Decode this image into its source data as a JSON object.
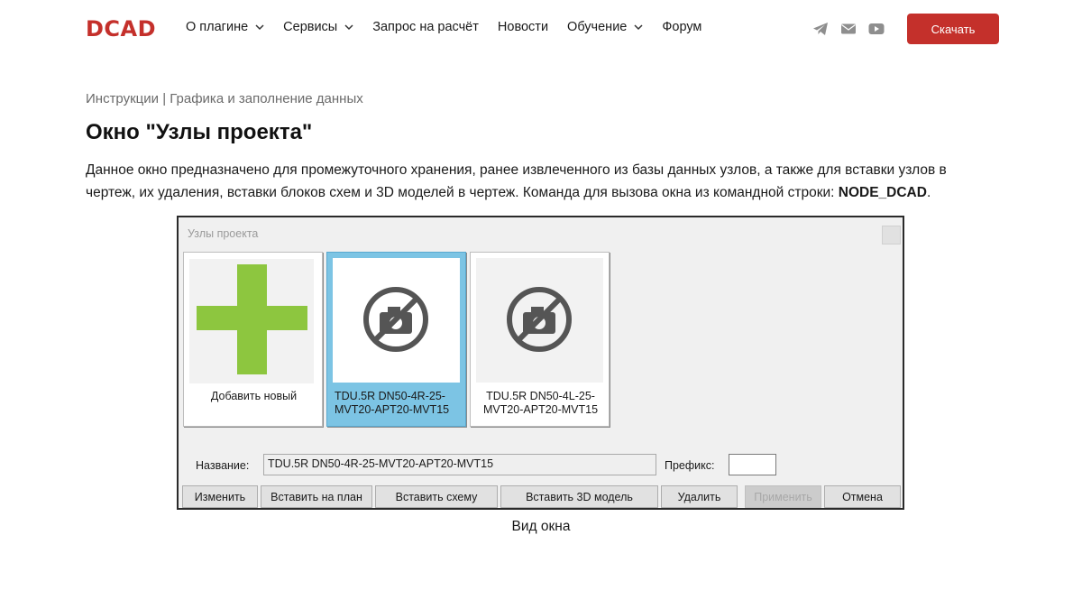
{
  "header": {
    "logo": "DCAD",
    "nav": [
      {
        "label": "О плагине",
        "dropdown": true
      },
      {
        "label": "Сервисы",
        "dropdown": true
      },
      {
        "label": "Запрос на расчёт",
        "dropdown": false
      },
      {
        "label": "Новости",
        "dropdown": false
      },
      {
        "label": "Обучение",
        "dropdown": true
      },
      {
        "label": "Форум",
        "dropdown": false
      }
    ],
    "socials": [
      "telegram-icon",
      "mail-icon",
      "youtube-icon"
    ],
    "download_label": "Скачать"
  },
  "breadcrumb": "Инструкции | Графика и заполнение данных",
  "title": "Окно \"Узлы проекта\"",
  "description": {
    "text": "Данное окно предназначено для промежуточного хранения, ранее извлеченного из базы данных узлов, а также для вставки узлов в чертеж, их удаления, вставки блоков схем и 3D моделей в чертеж. Команда для вызова окна из командной строки: ",
    "command": "NODE_DCAD",
    "end": "."
  },
  "window": {
    "title": "Узлы проекта",
    "tiles": [
      {
        "label": "Добавить новый",
        "icon": "plus-icon",
        "selected": false
      },
      {
        "label": "TDU.5R DN50-4R-25-MVT20-APT20-MVT15",
        "icon": "no-photo-icon",
        "selected": true
      },
      {
        "label": "TDU.5R DN50-4L-25-MVT20-APT20-MVT15",
        "icon": "no-photo-icon",
        "selected": false
      }
    ],
    "name_label": "Название:",
    "name_value": "TDU.5R DN50-4R-25-MVT20-APT20-MVT15",
    "prefix_label": "Префикс:",
    "prefix_value": "",
    "buttons": [
      {
        "label": "Изменить",
        "enabled": true
      },
      {
        "label": "Вставить на план",
        "enabled": true
      },
      {
        "label": "Вставить схему",
        "enabled": true
      },
      {
        "label": "Вставить 3D модель",
        "enabled": true
      },
      {
        "label": "Удалить",
        "enabled": true
      },
      {
        "label": "Применить",
        "enabled": false
      },
      {
        "label": "Отмена",
        "enabled": true
      }
    ]
  },
  "caption": "Вид окна",
  "colors": {
    "brand": "#c4302b",
    "plus": "#8dc63f",
    "selected_tile": "#7cc4e4"
  }
}
